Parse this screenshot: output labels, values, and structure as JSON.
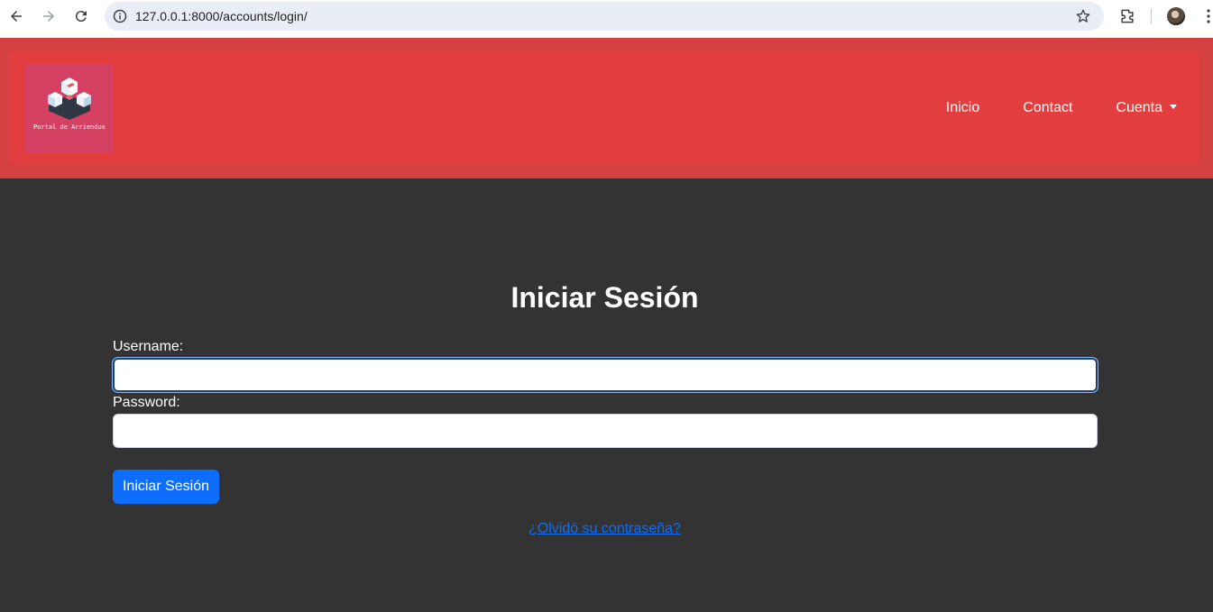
{
  "browser": {
    "url": "127.0.0.1:8000/accounts/login/"
  },
  "logo": {
    "text": "Portal de Arriendos"
  },
  "nav": {
    "items": [
      "Inicio",
      "Contact",
      "Cuenta"
    ]
  },
  "login": {
    "title": "Iniciar Sesión",
    "username_label": "Username:",
    "password_label": "Password:",
    "username_value": "",
    "password_value": "",
    "submit_label": "Iniciar Sesión",
    "forgot_link": "¿Olvidó su contraseña?"
  },
  "colors": {
    "header": "#d54042",
    "navbar": "#e33e3f",
    "body": "#333333",
    "primary": "#0d6efd"
  }
}
